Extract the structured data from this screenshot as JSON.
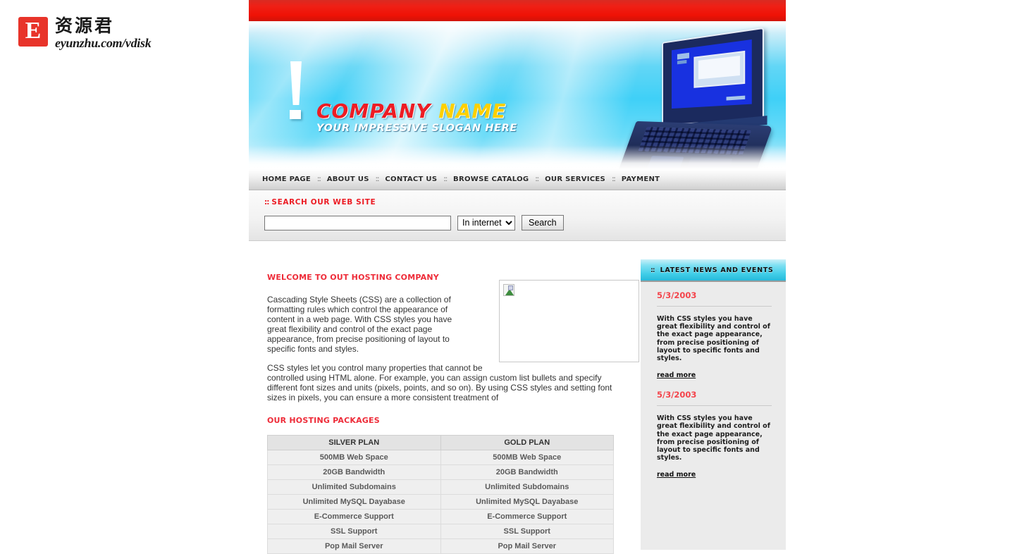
{
  "watermark": {
    "badge_letter": "E",
    "cn_text": "资源君",
    "url_text": "eyunzhu.com/vdisk"
  },
  "banner": {
    "company_name_part1": "COMPANY",
    "company_name_part2": "NAME",
    "slogan": "YOUR IMPRESSIVE SLOGAN HERE",
    "accent_red": "#ed1c24",
    "accent_yellow": "#ffd000"
  },
  "nav": {
    "separator": "::",
    "items": [
      {
        "label": "HOME PAGE"
      },
      {
        "label": "ABOUT US"
      },
      {
        "label": "CONTACT US"
      },
      {
        "label": "BROWSE CATALOG"
      },
      {
        "label": "OUR SERVICES"
      },
      {
        "label": "PAYMENT"
      }
    ]
  },
  "search": {
    "dots": "::",
    "title": "SEARCH OUR WEB SITE",
    "input_value": "",
    "input_placeholder": "",
    "scope_selected": "In internet",
    "scope_options": [
      "In internet"
    ],
    "button_label": "Search"
  },
  "main": {
    "welcome_title": "WELCOME TO OUT HOSTING COMPANY",
    "paragraph1": "Cascading Style Sheets (CSS) are a collection of formatting rules which control the appearance of content in a web page. With CSS styles you have great flexibility and control of the exact page appearance, from precise positioning of layout to specific fonts and styles.",
    "paragraph2": "CSS styles let you control many properties that cannot be controlled using HTML alone. For example, you can assign custom list bullets and specify different font sizes and units (pixels, points, and so on). By using CSS styles and setting font sizes in pixels, you can ensure a more consistent treatment of",
    "packages_title": "OUR HOSTING PACKAGES",
    "table": {
      "headers": [
        "SILVER PLAN",
        "GOLD PLAN"
      ],
      "rows": [
        [
          "500MB Web Space",
          "500MB Web Space"
        ],
        [
          "20GB Bandwidth",
          "20GB Bandwidth"
        ],
        [
          "Unlimited Subdomains",
          "Unlimited Subdomains"
        ],
        [
          "Unlimited MySQL Dayabase",
          "Unlimited MySQL Dayabase"
        ],
        [
          "E-Commerce Support",
          "E-Commerce Support"
        ],
        [
          "SSL Support",
          "SSL Support"
        ],
        [
          "Pop Mail Server",
          "Pop Mail Server"
        ]
      ]
    }
  },
  "sidebar": {
    "dots": "::",
    "title": "LATEST NEWS AND EVENTS",
    "news": [
      {
        "date": "5/3/2003",
        "text": "With CSS styles you have great flexibility and control of the exact page appearance, from precise positioning of layout to specific fonts and styles.",
        "more_label": "read more"
      },
      {
        "date": "5/3/2003",
        "text": "With CSS styles you have great flexibility and control of the exact page appearance, from precise positioning of layout to specific fonts and styles.",
        "more_label": "read more"
      }
    ]
  }
}
